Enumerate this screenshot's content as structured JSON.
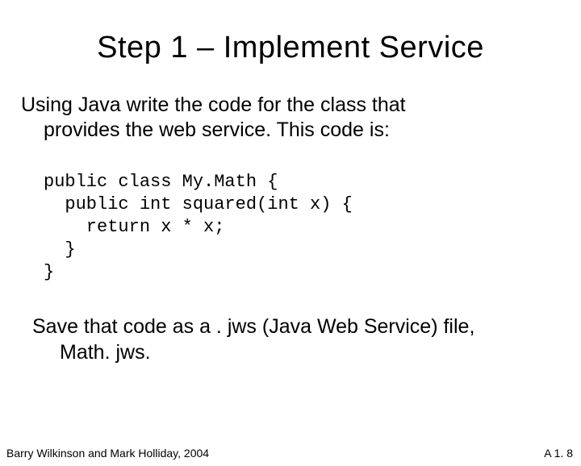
{
  "title": "Step 1 – Implement Service",
  "para": {
    "line1": "Using Java write the code for the class that",
    "line2": "provides the web service. This code is:"
  },
  "code": {
    "l1": "public class My.Math {",
    "l2": "  public int squared(int x) {",
    "l3": "    return x * x;",
    "l4": "  }",
    "l5": "}"
  },
  "save": {
    "line1": "Save that code as a . jws  (Java Web Service) file,",
    "line2": "Math. jws."
  },
  "footer": {
    "left": "Barry Wilkinson and Mark Holliday, 2004",
    "right": "A 1. 8"
  }
}
